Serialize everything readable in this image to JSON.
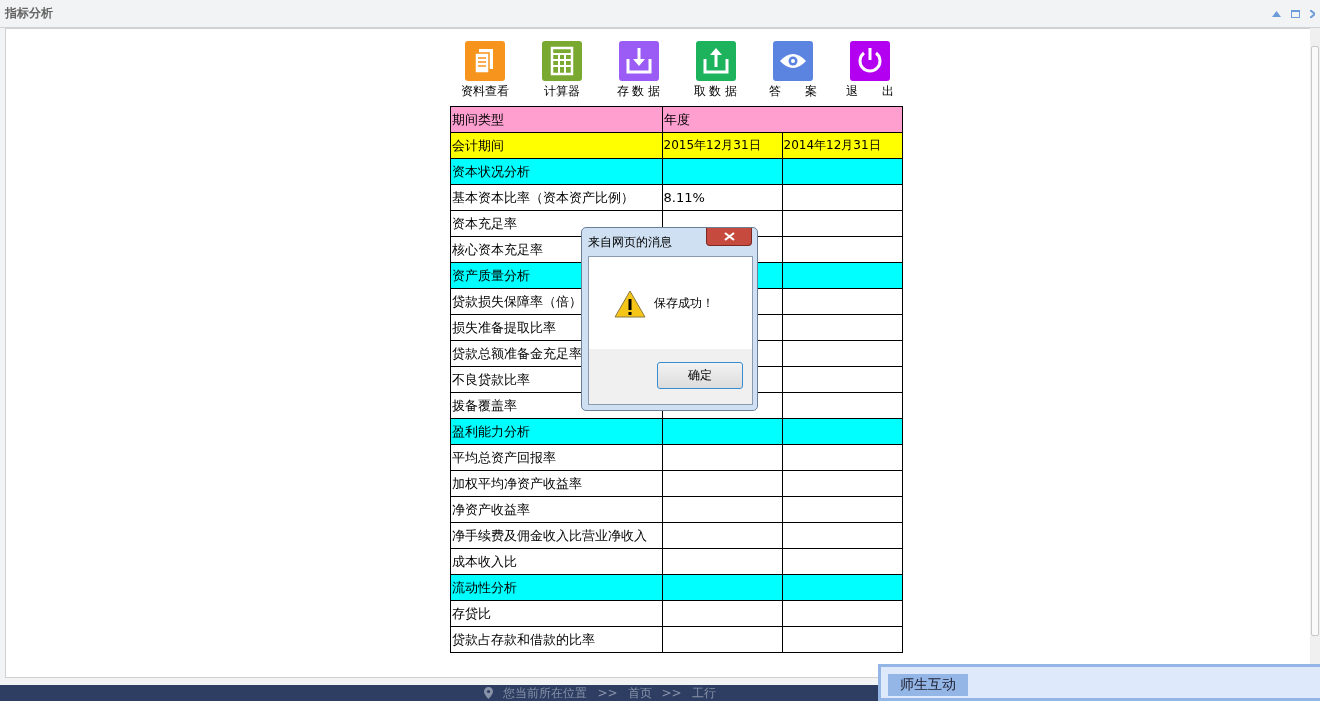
{
  "panel": {
    "title": "指标分析"
  },
  "toolbar": [
    {
      "label": "资料查看",
      "kind": "docs",
      "color": "#f7941d"
    },
    {
      "label": "计算器",
      "kind": "calculator",
      "color": "#7aa932"
    },
    {
      "label": "存 数 据",
      "kind": "download",
      "color": "#9b5cf6"
    },
    {
      "label": "取 数 据",
      "kind": "upload",
      "color": "#1db35c"
    },
    {
      "label": "答　　案",
      "kind": "eye",
      "color": "#5b83e0"
    },
    {
      "label": "退　　出",
      "kind": "power",
      "color": "#b400f0"
    }
  ],
  "table": {
    "rows": [
      {
        "kind": "header",
        "cells": [
          "期间类型",
          {
            "text": "年度",
            "colspan": 2
          }
        ]
      },
      {
        "kind": "period",
        "cells": [
          "会计期间",
          "2015年12月31日",
          "2014年12月31日"
        ]
      },
      {
        "kind": "section",
        "cells": [
          "资本状况分析",
          "",
          ""
        ]
      },
      {
        "kind": "item",
        "cells": [
          "基本资本比率（资本资产比例）",
          "8.11%",
          ""
        ]
      },
      {
        "kind": "item",
        "cells": [
          "资本充足率",
          "",
          ""
        ]
      },
      {
        "kind": "item",
        "cells": [
          "核心资本充足率",
          "",
          ""
        ]
      },
      {
        "kind": "section",
        "cells": [
          "资产质量分析",
          "",
          ""
        ]
      },
      {
        "kind": "item",
        "cells": [
          "贷款损失保障率（倍）",
          "",
          ""
        ]
      },
      {
        "kind": "item",
        "cells": [
          "损失准备提取比率",
          "",
          ""
        ]
      },
      {
        "kind": "item",
        "cells": [
          "贷款总额准备金充足率",
          "",
          ""
        ]
      },
      {
        "kind": "item",
        "cells": [
          "不良贷款比率",
          "",
          ""
        ]
      },
      {
        "kind": "item",
        "cells": [
          "拨备覆盖率",
          "",
          ""
        ]
      },
      {
        "kind": "section",
        "cells": [
          "盈利能力分析",
          "",
          ""
        ]
      },
      {
        "kind": "item",
        "cells": [
          "平均总资产回报率",
          "",
          ""
        ]
      },
      {
        "kind": "item",
        "cells": [
          "加权平均净资产收益率",
          "",
          ""
        ]
      },
      {
        "kind": "item",
        "cells": [
          "净资产收益率",
          "",
          ""
        ]
      },
      {
        "kind": "item",
        "cells": [
          "净手续费及佣金收入比营业净收入",
          "",
          ""
        ]
      },
      {
        "kind": "item",
        "cells": [
          "成本收入比",
          "",
          ""
        ]
      },
      {
        "kind": "section",
        "cells": [
          "流动性分析",
          "",
          ""
        ]
      },
      {
        "kind": "item",
        "cells": [
          "存贷比",
          "",
          ""
        ]
      },
      {
        "kind": "item",
        "cells": [
          "贷款占存款和借款的比率",
          "",
          ""
        ]
      }
    ]
  },
  "dialog": {
    "title": "来自网页的消息",
    "message": "保存成功！",
    "button": "确定"
  },
  "breadcrumb": {
    "prefix": "您当前所在位置",
    "separator_1": ">>",
    "home": "首页",
    "separator_2": ">>",
    "current": "工行"
  },
  "chat_panel": {
    "tab": "师生互动"
  }
}
